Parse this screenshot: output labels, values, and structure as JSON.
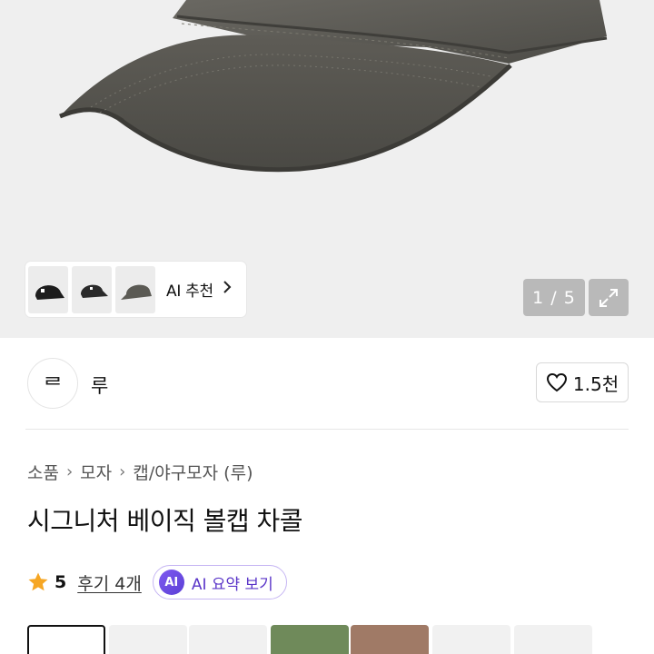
{
  "hero": {
    "image_alt": "",
    "counter": "1 / 5",
    "reco_label": "AI 추천"
  },
  "seller": {
    "logo_text": "ᄅ",
    "name": "루",
    "like_count": "1.5천"
  },
  "breadcrumb": [
    "소품",
    "모자",
    "캡/야구모자 (루)"
  ],
  "product": {
    "title": "시그니처 베이직 볼캡 차콜",
    "rating": "5",
    "reviews": "후기 4개",
    "ai_summary_badge": "AI",
    "ai_summary_label": "AI 요약 보기"
  },
  "colors": {
    "cap": "#5b5a54",
    "accent": "#6a45e0",
    "star": "#f6a623"
  },
  "icons": {
    "reco": "chevron-right-icon",
    "expand": "expand-icon",
    "like": "heart-icon",
    "rating": "star-icon"
  }
}
